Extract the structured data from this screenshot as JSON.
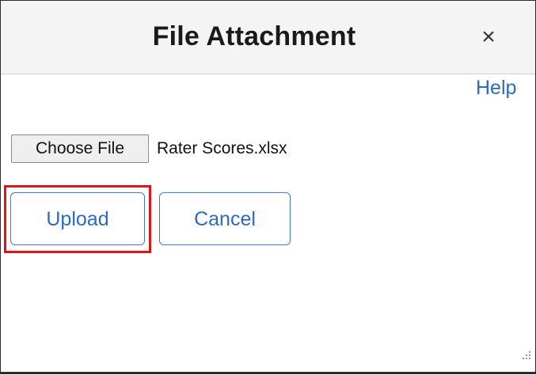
{
  "dialog": {
    "title": "File Attachment",
    "close_glyph": "×",
    "help_label": "Help"
  },
  "file_picker": {
    "button_label": "Choose File",
    "selected_file": "Rater Scores.xlsx"
  },
  "actions": {
    "upload_label": "Upload",
    "cancel_label": "Cancel"
  },
  "icons": {
    "close": "close-icon",
    "resize": "resize-grip-icon"
  },
  "colors": {
    "link": "#2e6ac2",
    "button_border": "#3e7bd6",
    "highlight": "#e01414",
    "titlebar_bg": "#f4f4f4"
  }
}
